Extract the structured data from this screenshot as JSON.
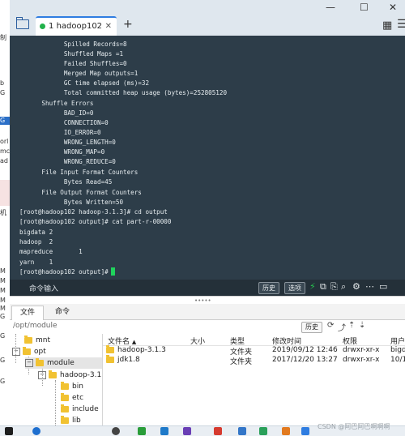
{
  "window": {
    "title": "hadoop102",
    "tab_number": "1",
    "new_tab": "+",
    "minimize": "—",
    "maximize": "☐",
    "close": "✕"
  },
  "left_strip": {
    "items": [
      "制",
      "",
      "b",
      "G",
      "G",
      "",
      "orl",
      "mc",
      "ad",
      "",
      "",
      "",
      "",
      "机",
      "M",
      "",
      "M",
      "",
      "M",
      "M",
      "M",
      "G",
      "G",
      "G",
      "G"
    ]
  },
  "terminal": {
    "lines": [
      "            Spilled Records=8",
      "            Shuffled Maps =1",
      "            Failed Shuffles=0",
      "            Merged Map outputs=1",
      "            GC time elapsed (ms)=32",
      "            Total committed heap usage (bytes)=252805120",
      "      Shuffle Errors",
      "            BAD_ID=0",
      "            CONNECTION=0",
      "            IO_ERROR=0",
      "            WRONG_LENGTH=0",
      "            WRONG_MAP=0",
      "            WRONG_REDUCE=0",
      "      File Input Format Counters",
      "            Bytes Read=45",
      "      File Output Format Counters",
      "            Bytes Written=50",
      "[root@hadoop102 hadoop-3.1.3]# cd output",
      "[root@hadoop102 output]# cat part-r-00000",
      "bigdata 2",
      "hadoop  2",
      "mapreduce       1",
      "yarn    1",
      "[root@hadoop102 output]# "
    ]
  },
  "command_bar": {
    "label": "命令输入",
    "history": "历史",
    "options": "选项"
  },
  "file_panel": {
    "tabs": [
      "文件",
      "命令"
    ],
    "path": "/opt/module",
    "history": "历史",
    "tree": [
      {
        "label": "mnt",
        "level": 1,
        "expander": ""
      },
      {
        "label": "opt",
        "level": 1,
        "expander": "−"
      },
      {
        "label": "module",
        "level": 2,
        "expander": "−"
      },
      {
        "label": "hadoop-3.1",
        "level": 3,
        "expander": "−"
      },
      {
        "label": "bin",
        "level": 4,
        "expander": ""
      },
      {
        "label": "etc",
        "level": 4,
        "expander": ""
      },
      {
        "label": "include",
        "level": 4,
        "expander": ""
      },
      {
        "label": "lib",
        "level": 4,
        "expander": ""
      }
    ],
    "columns": [
      "文件名",
      "大小",
      "类型",
      "修改时间",
      "权限",
      "用户"
    ],
    "sort_indicator": "▲",
    "files": [
      {
        "name": "hadoop-3.1.3",
        "size": "",
        "type": "文件夹",
        "modified": "2019/09/12 12:46",
        "perm": "drwxr-xr-x",
        "user": "bigd"
      },
      {
        "name": "jdk1.8",
        "size": "",
        "type": "文件夹",
        "modified": "2017/12/20 13:27",
        "perm": "drwxr-xr-x",
        "user": "10/1"
      }
    ]
  },
  "watermark": "CSDN @阿巴阿巴啊啊啊",
  "colors": {
    "terminal_bg": "#2d3d49",
    "prompt_cursor": "#1fd35c",
    "tab_accent": "#2f7de1",
    "folder": "#f1c232"
  }
}
